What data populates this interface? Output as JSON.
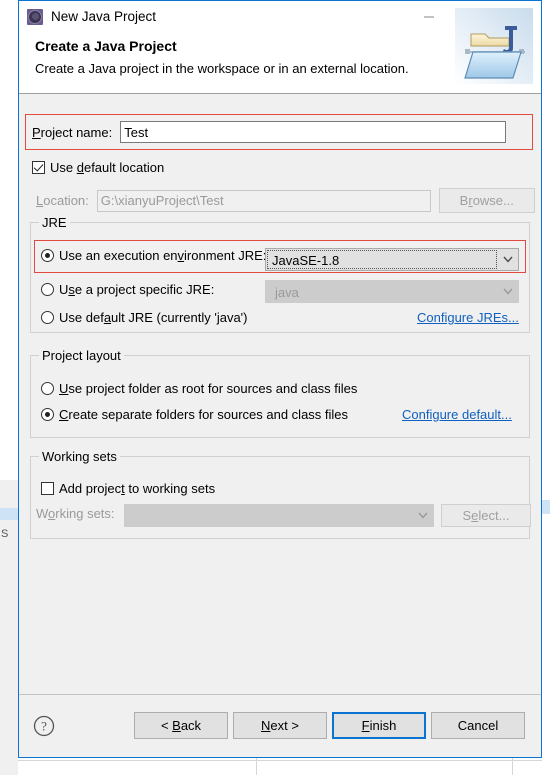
{
  "window": {
    "title": "New Java Project",
    "icon": "eclipse-java-icon",
    "controls": {
      "minimize": "minimize-icon",
      "maximize": "maximize-icon",
      "close": "close-icon"
    }
  },
  "banner": {
    "title": "Create a Java Project",
    "subtitle": "Create a Java project in the workspace or in an external location.",
    "icon": "java-folder-icon"
  },
  "project_name": {
    "label": "Project name:",
    "label_mnemonic": "P",
    "value": "Test",
    "highlighted": true,
    "highlight_color": "#e04a3f"
  },
  "location": {
    "use_default_label": "Use default location",
    "use_default_mnemonic": "d",
    "use_default_checked": true,
    "label": "Location:",
    "label_mnemonic": "L",
    "value": "G:\\xianyuProject\\Test",
    "browse_label": "Browse...",
    "browse_mnemonic": "r",
    "disabled": true
  },
  "jre": {
    "group_title": "JRE",
    "options": [
      {
        "label": "Use an execution environment JRE:",
        "mnemonic": "v",
        "selected": true,
        "combo_value": "JavaSE-1.8",
        "combo_enabled": true,
        "highlighted": true
      },
      {
        "label": "Use a project specific JRE:",
        "mnemonic": "s",
        "selected": false,
        "combo_value": "java",
        "combo_enabled": false,
        "highlighted": false
      },
      {
        "label": "Use default JRE (currently 'java')",
        "mnemonic": "a",
        "selected": false,
        "combo_value": null,
        "combo_enabled": false,
        "highlighted": false
      }
    ],
    "configure_link": "Configure JREs...",
    "link_color": "#1060c0"
  },
  "project_layout": {
    "group_title": "Project layout",
    "options": [
      {
        "label": "Use project folder as root for sources and class files",
        "mnemonic": "U",
        "selected": false
      },
      {
        "label": "Create separate folders for sources and class files",
        "mnemonic": "C",
        "selected": true
      }
    ],
    "configure_link": "Configure default..."
  },
  "working_sets": {
    "group_title": "Working sets",
    "add_label": "Add project to working sets",
    "add_mnemonic": "t",
    "add_checked": false,
    "label": "Working sets:",
    "label_mnemonic": "o",
    "combo_value": "",
    "select_label": "Select...",
    "select_mnemonic": "e",
    "disabled": true
  },
  "footer": {
    "help_icon": "help-question-icon",
    "buttons": [
      {
        "label": "< Back",
        "mnemonic": "B",
        "default": false,
        "enabled": true
      },
      {
        "label": "Next >",
        "mnemonic": "N",
        "default": false,
        "enabled": true
      },
      {
        "label": "Finish",
        "mnemonic": "F",
        "default": true,
        "enabled": true
      },
      {
        "label": "Cancel",
        "mnemonic": "",
        "default": false,
        "enabled": true
      }
    ]
  },
  "background": {
    "left_label": "S"
  }
}
